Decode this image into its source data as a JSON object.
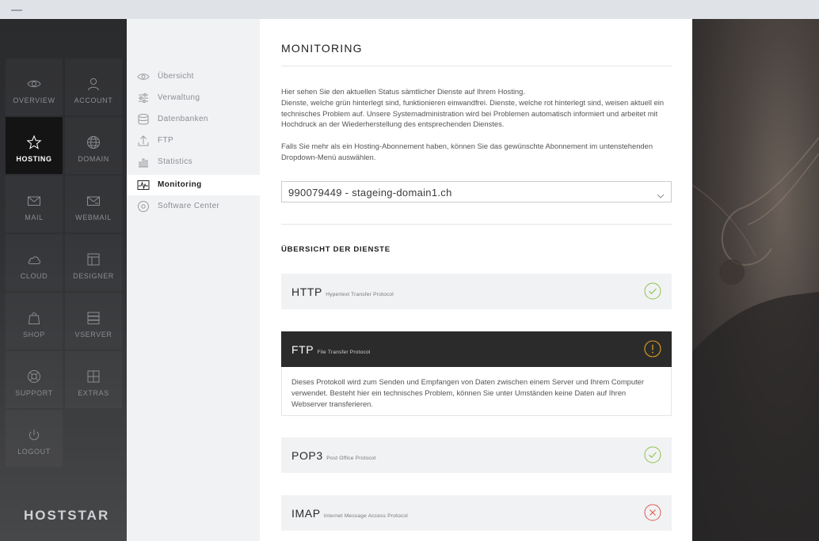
{
  "nav": {
    "tiles": [
      {
        "label": "OVERVIEW",
        "icon": "eye-icon"
      },
      {
        "label": "ACCOUNT",
        "icon": "user-icon"
      },
      {
        "label": "HOSTING",
        "icon": "star-icon",
        "active": true
      },
      {
        "label": "DOMAIN",
        "icon": "globe-icon"
      },
      {
        "label": "MAIL",
        "icon": "envelope-icon"
      },
      {
        "label": "WEBMAIL",
        "icon": "envelope-send-icon"
      },
      {
        "label": "CLOUD",
        "icon": "cloud-icon"
      },
      {
        "label": "DESIGNER",
        "icon": "layout-icon"
      },
      {
        "label": "SHOP",
        "icon": "shopping-bag-icon"
      },
      {
        "label": "VSERVER",
        "icon": "server-icon"
      },
      {
        "label": "SUPPORT",
        "icon": "lifebuoy-icon"
      },
      {
        "label": "EXTRAS",
        "icon": "grid-plus-icon"
      },
      {
        "label": "LOGOUT",
        "icon": "power-icon"
      }
    ],
    "logo": "HOSTSTAR"
  },
  "submenu": {
    "items": [
      {
        "label": "Übersicht",
        "icon": "eye-icon"
      },
      {
        "label": "Verwaltung",
        "icon": "sliders-icon"
      },
      {
        "label": "Datenbanken",
        "icon": "database-icon"
      },
      {
        "label": "FTP",
        "icon": "upload-icon"
      },
      {
        "label": "Statistics",
        "icon": "bar-chart-icon"
      },
      {
        "label": "Monitoring",
        "icon": "pulse-icon",
        "active": true
      },
      {
        "label": "Software Center",
        "icon": "disc-icon"
      }
    ]
  },
  "main": {
    "title": "MONITORING",
    "intro": "Hier sehen Sie den aktuellen Status sämtlicher Dienste auf Ihrem Hosting.\nDienste, welche grün hinterlegt sind, funktionieren einwandfrei. Dienste, welche rot hinterlegt sind, weisen aktuell ein technisches Problem auf. Unsere Systemadministration wird bei Problemen automatisch informiert und arbeitet mit Hochdruck an der Wiederherstellung des entsprechenden Dienstes.",
    "intro2": "Falls Sie mehr als ein Hosting-Abonnement haben, können Sie das gewünschte Abonnement im untenstehenden Dropdown-Menü auswählen.",
    "dropdown_value": "990079449 - stageing-domain1.ch",
    "section_title": "ÜBERSICHT DER DIENSTE",
    "services": [
      {
        "name": "HTTP",
        "desc": "Hypertext Transfer Protocol",
        "status": "ok"
      },
      {
        "name": "FTP",
        "desc": "File Transfer Protocol",
        "status": "warning",
        "details": "Dieses Protokoll wird zum Senden und Empfangen von Daten zwischen einem Server und Ihrem Computer verwendet. Besteht hier ein technisches Problem, können Sie unter Umständen keine Daten auf Ihren Webserver transferieren."
      },
      {
        "name": "POP3",
        "desc": "Post Office Protocol",
        "status": "ok"
      },
      {
        "name": "IMAP",
        "desc": "Internet Message Access Protocol",
        "status": "error"
      }
    ]
  },
  "colors": {
    "ok": "#8bc34a",
    "warning": "#e0a020",
    "error": "#e05a4e",
    "active_tile": "#141414"
  }
}
